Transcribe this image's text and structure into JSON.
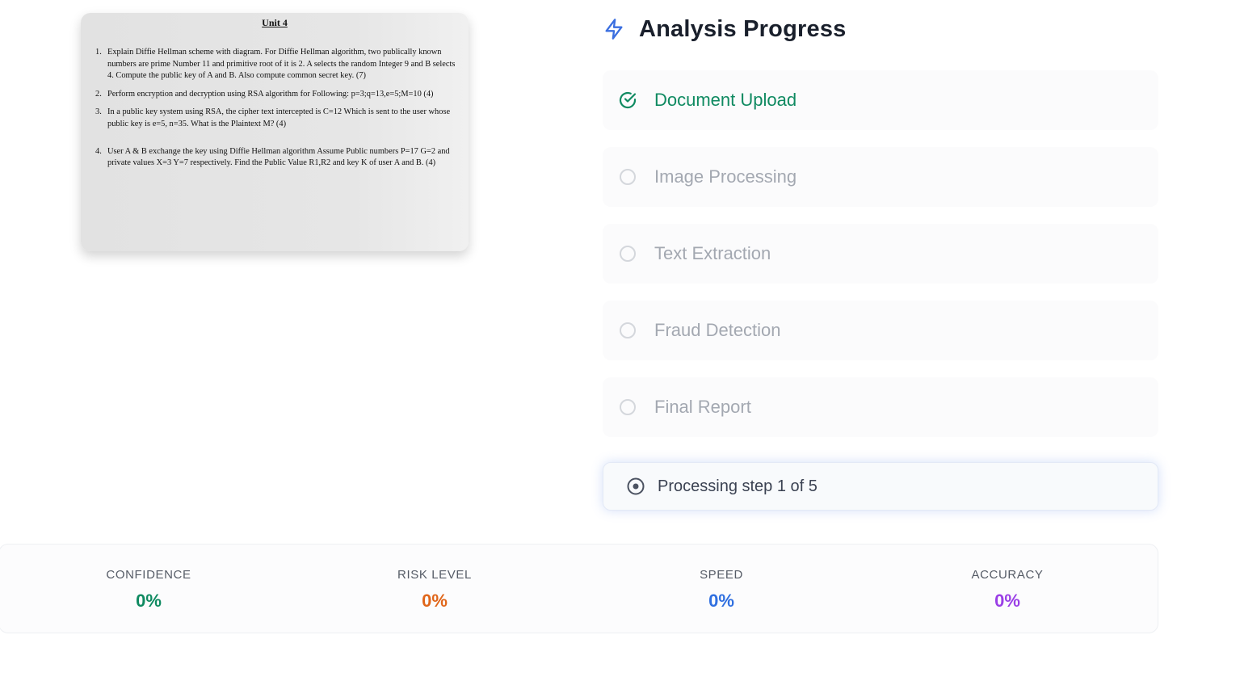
{
  "document": {
    "title": "Unit 4",
    "questions": [
      {
        "num": "1.",
        "text": "Explain Diffie Hellman scheme with diagram. For Diffie Hellman algorithm, two publically known numbers are prime Number 11 and primitive root of it is 2. A selects the random Integer 9 and B selects 4. Compute the public key of A and B. Also compute common secret key. (7)"
      },
      {
        "num": "2.",
        "text": "Perform encryption and decryption using RSA algorithm for Following: p=3;q=13,e=5;M=10 (4)"
      },
      {
        "num": "3.",
        "text": "In a public key system using RSA, the cipher text intercepted is C=12 Which is sent to the user whose public key is e=5, n=35. What is the Plaintext M? (4)"
      },
      {
        "num": "4.",
        "text": "User A & B exchange the key using Diffie Hellman algorithm Assume Public numbers P=17 G=2 and private values X=3 Y=7 respectively. Find the Public Value R1,R2 and key K of user A and B. (4)"
      }
    ]
  },
  "progress": {
    "heading_icon": "lightning-icon",
    "title": "Analysis Progress",
    "steps": [
      {
        "label": "Document Upload",
        "state": "done",
        "icon": "check-circle-icon"
      },
      {
        "label": "Image Processing",
        "state": "pending",
        "icon": "empty-circle-icon"
      },
      {
        "label": "Text Extraction",
        "state": "pending",
        "icon": "empty-circle-icon"
      },
      {
        "label": "Fraud Detection",
        "state": "pending",
        "icon": "empty-circle-icon"
      },
      {
        "label": "Final Report",
        "state": "pending",
        "icon": "empty-circle-icon"
      }
    ],
    "status_icon": "radio-dot-icon",
    "status_text": "Processing step 1 of 5"
  },
  "metrics": [
    {
      "label": "CONFIDENCE",
      "value": "0%",
      "color": "#0f8a61"
    },
    {
      "label": "RISK LEVEL",
      "value": "0%",
      "color": "#e0661a"
    },
    {
      "label": "SPEED",
      "value": "0%",
      "color": "#2f6fe0"
    },
    {
      "label": "ACCURACY",
      "value": "0%",
      "color": "#9a3fe6"
    }
  ],
  "colors": {
    "accent_blue": "#3b6fe0",
    "done_green": "#0f8a61",
    "pending_gray": "#a3a8b1"
  }
}
